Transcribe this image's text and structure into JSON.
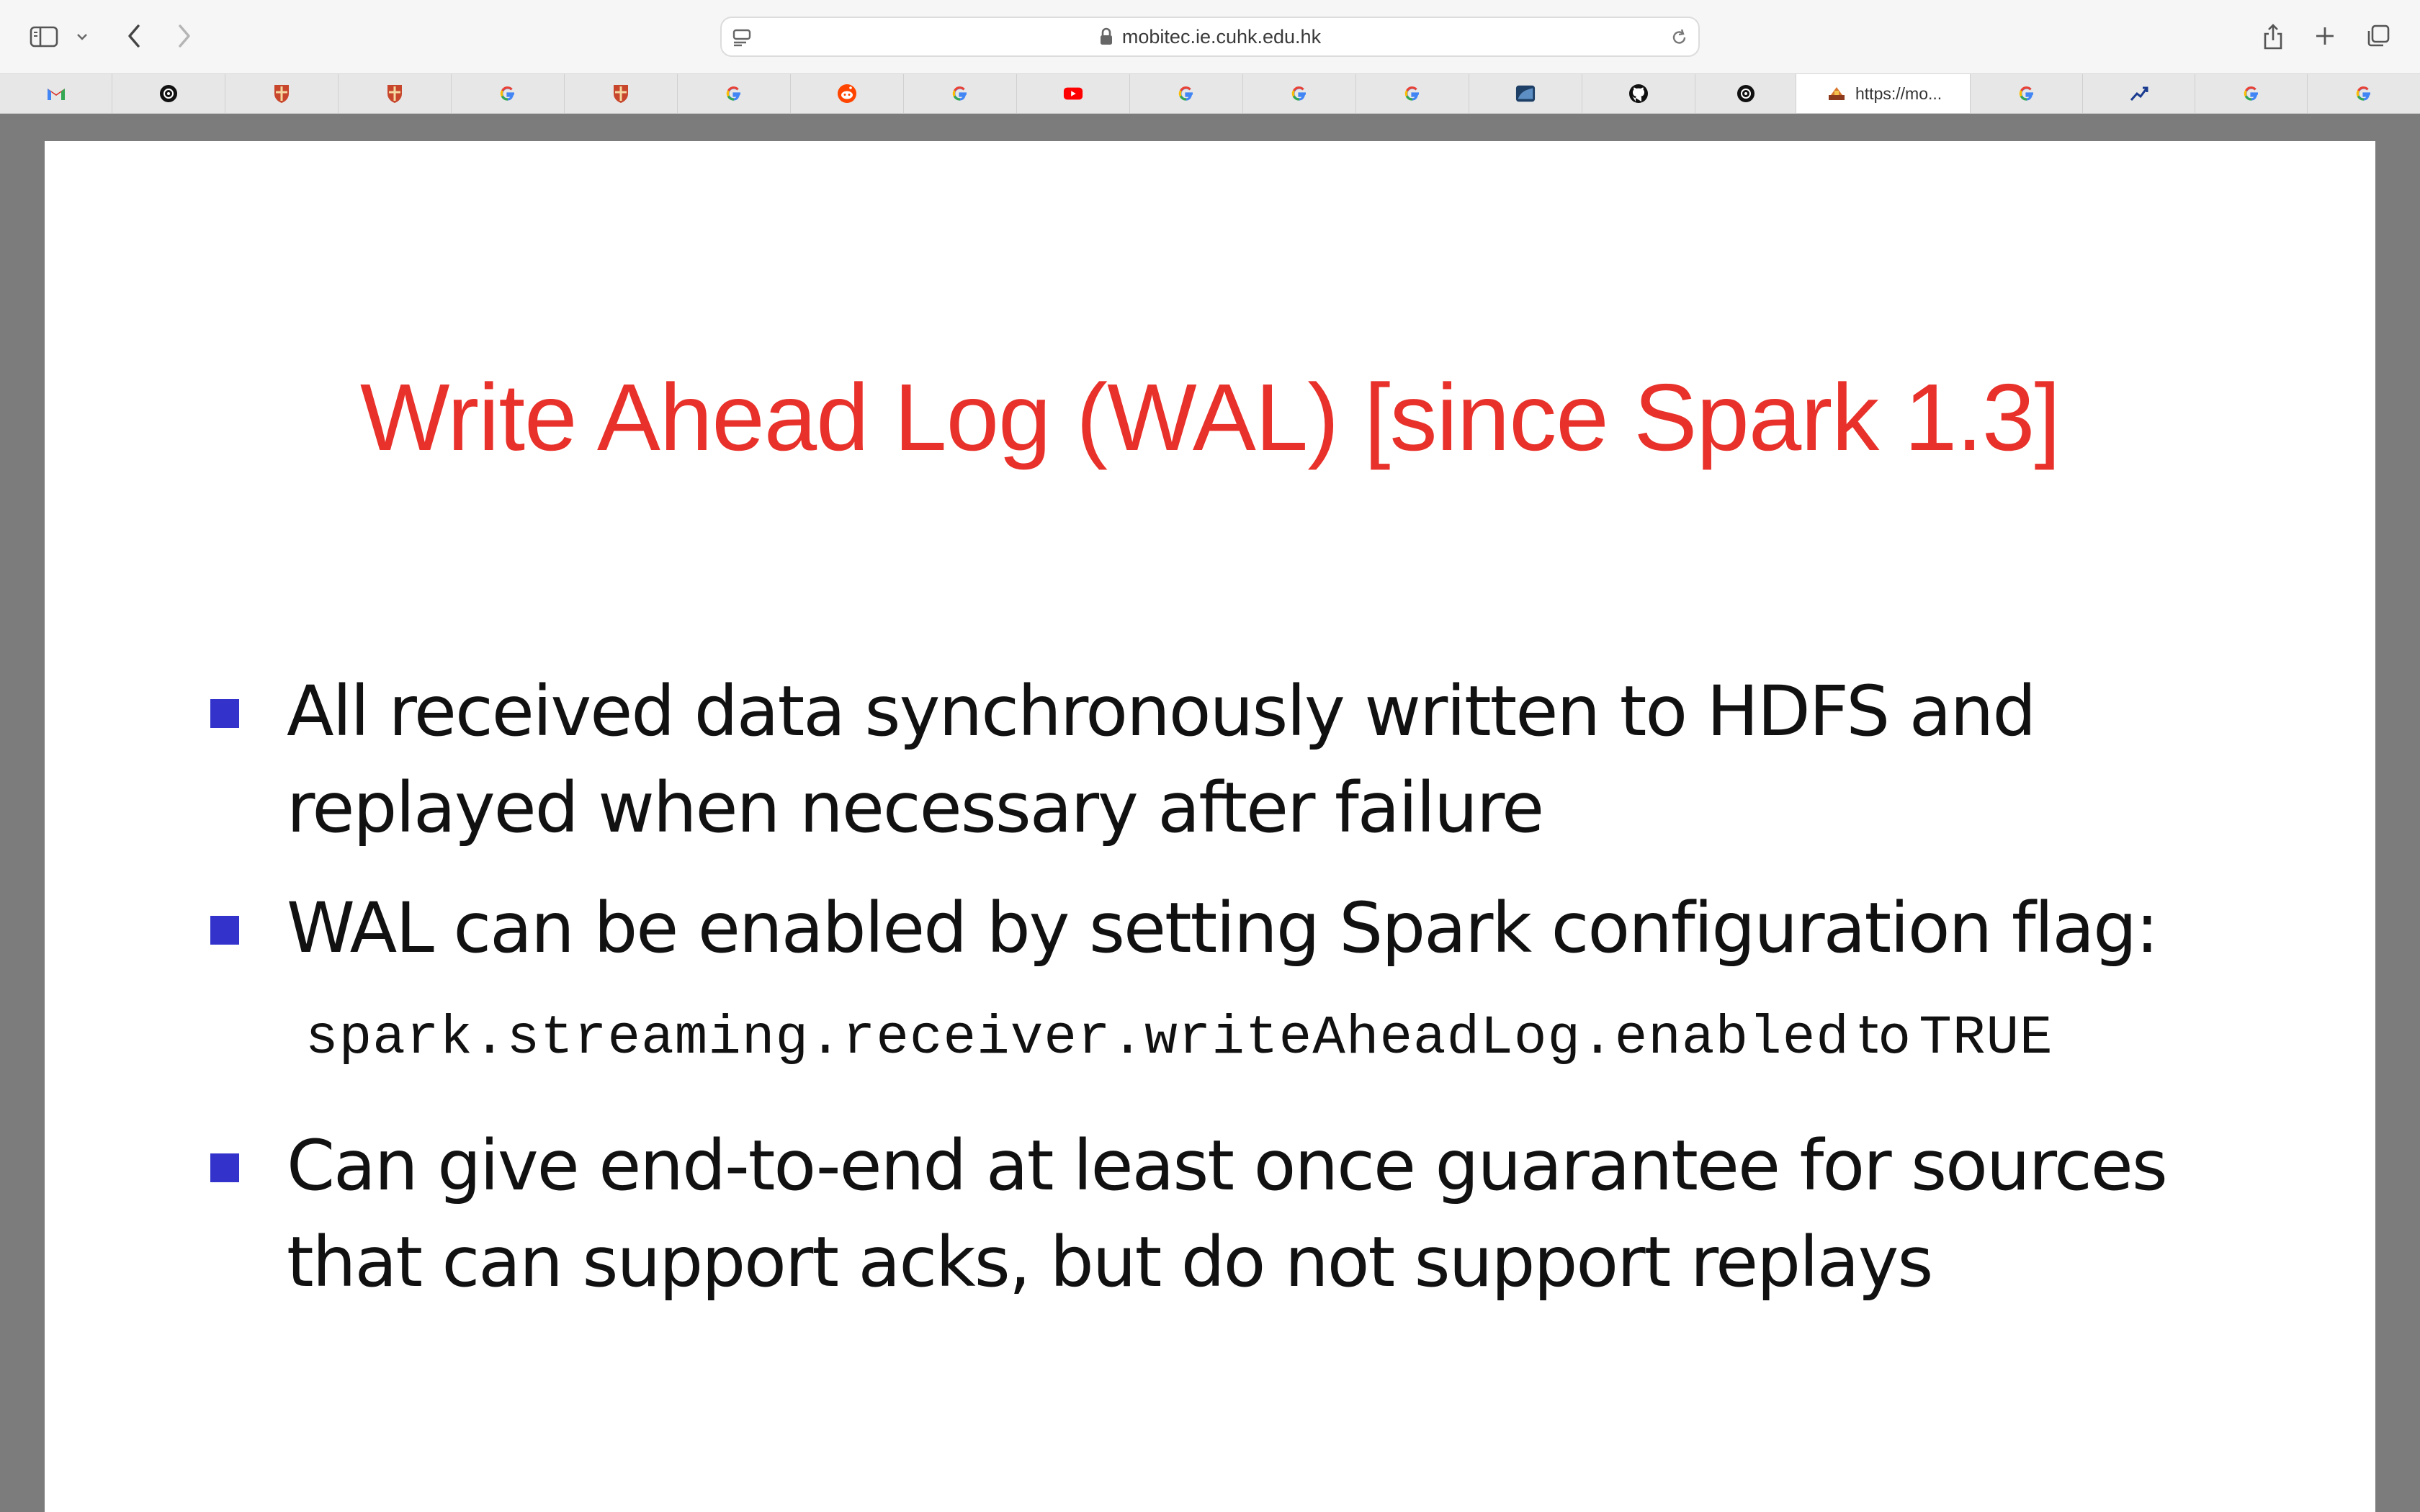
{
  "browser": {
    "url": "mobitec.ie.cuhk.edu.hk",
    "icons": {
      "sidebar": "sidebar-icon",
      "chevron": "chevron-down-icon",
      "back": "back-arrow-icon",
      "forward": "forward-arrow-icon",
      "page_menu": "page-menu-icon",
      "lock": "lock-icon",
      "reload": "reload-icon",
      "share": "share-icon",
      "new_tab": "plus-icon",
      "tab_overview": "tab-overview-icon"
    }
  },
  "tabs": [
    {
      "icon": "gmail-icon",
      "label": ""
    },
    {
      "icon": "openai-icon",
      "label": ""
    },
    {
      "icon": "cambridge-shield-icon",
      "label": ""
    },
    {
      "icon": "cambridge-shield-icon",
      "label": ""
    },
    {
      "icon": "google-icon",
      "label": ""
    },
    {
      "icon": "cambridge-shield-icon",
      "label": ""
    },
    {
      "icon": "google-icon",
      "label": ""
    },
    {
      "icon": "reddit-icon",
      "label": ""
    },
    {
      "icon": "google-icon",
      "label": ""
    },
    {
      "icon": "youtube-icon",
      "label": ""
    },
    {
      "icon": "google-icon",
      "label": ""
    },
    {
      "icon": "google-icon",
      "label": ""
    },
    {
      "icon": "google-icon",
      "label": ""
    },
    {
      "icon": "app-window-icon",
      "label": ""
    },
    {
      "icon": "github-icon",
      "label": ""
    },
    {
      "icon": "openai-icon",
      "label": ""
    },
    {
      "icon": "mobitec-icon",
      "label": "https://mo..."
    },
    {
      "icon": "google-icon",
      "label": ""
    },
    {
      "icon": "trend-chart-icon",
      "label": ""
    },
    {
      "icon": "google-icon",
      "label": ""
    },
    {
      "icon": "google-icon",
      "label": ""
    }
  ],
  "slide": {
    "title": "Write Ahead Log (WAL) [since Spark 1.3]",
    "title_color": "#e8312a",
    "bullet_color": "#3333cc",
    "bullets": [
      {
        "line1": "All received data synchronously written to HDFS and",
        "line2": "replayed when necessary after failure"
      },
      {
        "line1": "WAL can be enabled by setting Spark configuration flag:"
      },
      {
        "line1": "Can give end-to-end at least once guarantee for sources",
        "line2": "that can support acks, but do not support replays"
      }
    ],
    "config": {
      "flag": "spark.streaming.receiver.writeAheadLog.enabled",
      "to_word": "to",
      "value": "TRUE"
    }
  }
}
